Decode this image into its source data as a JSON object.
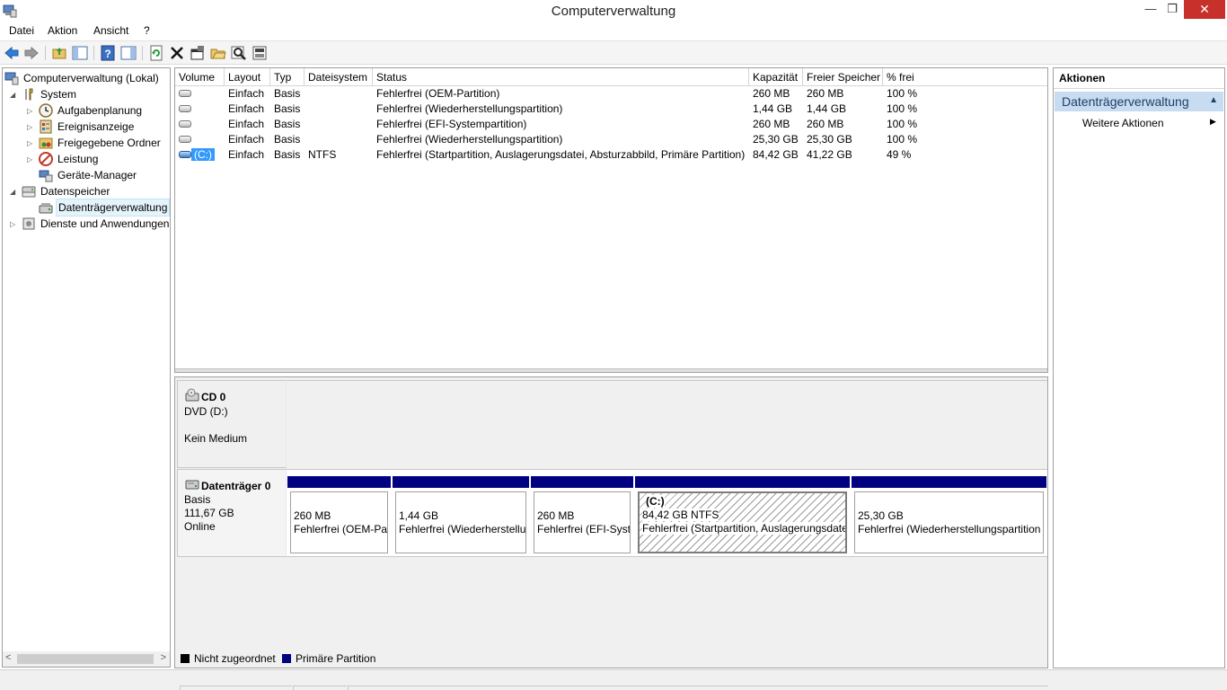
{
  "window": {
    "title": "Computerverwaltung",
    "min_glyph": "—",
    "max_glyph": "❐",
    "close_glyph": "✕"
  },
  "menu": {
    "items": [
      "Datei",
      "Aktion",
      "Ansicht",
      "?"
    ]
  },
  "toolbar": {
    "icons": [
      "back-arrow-icon",
      "forward-arrow-icon",
      "up-folder-icon",
      "show-hide-tree-icon",
      "help-icon",
      "show-hide-action-icon",
      "refresh-icon",
      "delete-icon",
      "properties-icon",
      "open-folder-icon",
      "search-icon",
      "settings-icon"
    ]
  },
  "tree": {
    "root": "Computerverwaltung (Lokal)",
    "system": "System",
    "aufgaben": "Aufgabenplanung",
    "ereignis": "Ereignisanzeige",
    "freigaben": "Freigegebene Ordner",
    "leistung": "Leistung",
    "geraete": "Geräte-Manager",
    "datenspeicher": "Datenspeicher",
    "datentraeger": "Datenträgerverwaltung",
    "dienste": "Dienste und Anwendungen",
    "scroll_left": "<",
    "scroll_right": ">"
  },
  "volumes": {
    "headers": [
      "Volume",
      "Layout",
      "Typ",
      "Dateisystem",
      "Status",
      "Kapazität",
      "Freier Speicher",
      "% frei"
    ],
    "rows": [
      {
        "volume": "",
        "layout": "Einfach",
        "typ": "Basis",
        "fs": "",
        "status": "Fehlerfrei (OEM-Partition)",
        "kap": "260 MB",
        "frei": "260 MB",
        "pct": "100 %"
      },
      {
        "volume": "",
        "layout": "Einfach",
        "typ": "Basis",
        "fs": "",
        "status": "Fehlerfrei (Wiederherstellungspartition)",
        "kap": "1,44 GB",
        "frei": "1,44 GB",
        "pct": "100 %"
      },
      {
        "volume": "",
        "layout": "Einfach",
        "typ": "Basis",
        "fs": "",
        "status": "Fehlerfrei (EFI-Systempartition)",
        "kap": "260 MB",
        "frei": "260 MB",
        "pct": "100 %"
      },
      {
        "volume": "",
        "layout": "Einfach",
        "typ": "Basis",
        "fs": "",
        "status": "Fehlerfrei (Wiederherstellungspartition)",
        "kap": "25,30 GB",
        "frei": "25,30 GB",
        "pct": "100 %"
      },
      {
        "volume": "(C:)",
        "layout": "Einfach",
        "typ": "Basis",
        "fs": "NTFS",
        "status": "Fehlerfrei (Startpartition, Auslagerungsdatei, Absturzabbild, Primäre Partition)",
        "kap": "84,42 GB",
        "frei": "41,22 GB",
        "pct": "49 %"
      }
    ]
  },
  "disks": {
    "cd0": {
      "name": "CD 0",
      "type": "DVD (D:)",
      "state": "Kein Medium"
    },
    "disk0": {
      "name": "Datenträger 0",
      "type": "Basis",
      "size": "111,67 GB",
      "state": "Online",
      "partitions": [
        {
          "label": "",
          "size": "260 MB",
          "status": "Fehlerfrei (OEM-Pa"
        },
        {
          "label": "",
          "size": "1,44 GB",
          "status": "Fehlerfrei (Wiederherstellu"
        },
        {
          "label": "",
          "size": "260 MB",
          "status": "Fehlerfrei (EFI-Syste"
        },
        {
          "label": "(C:)",
          "size": "84,42 GB NTFS",
          "status": "Fehlerfrei (Startpartition, Auslagerungsdate"
        },
        {
          "label": "",
          "size": "25,30 GB",
          "status": "Fehlerfrei (Wiederherstellungspartition"
        }
      ]
    }
  },
  "legend": {
    "unallocated": {
      "label": "Nicht zugeordnet",
      "color": "#000000"
    },
    "primary": {
      "label": "Primäre Partition",
      "color": "#000080"
    }
  },
  "actions": {
    "header": "Aktionen",
    "section": "Datenträgerverwaltung",
    "section_arrow": "▲",
    "item": "Weitere Aktionen",
    "item_arrow": "▶"
  }
}
